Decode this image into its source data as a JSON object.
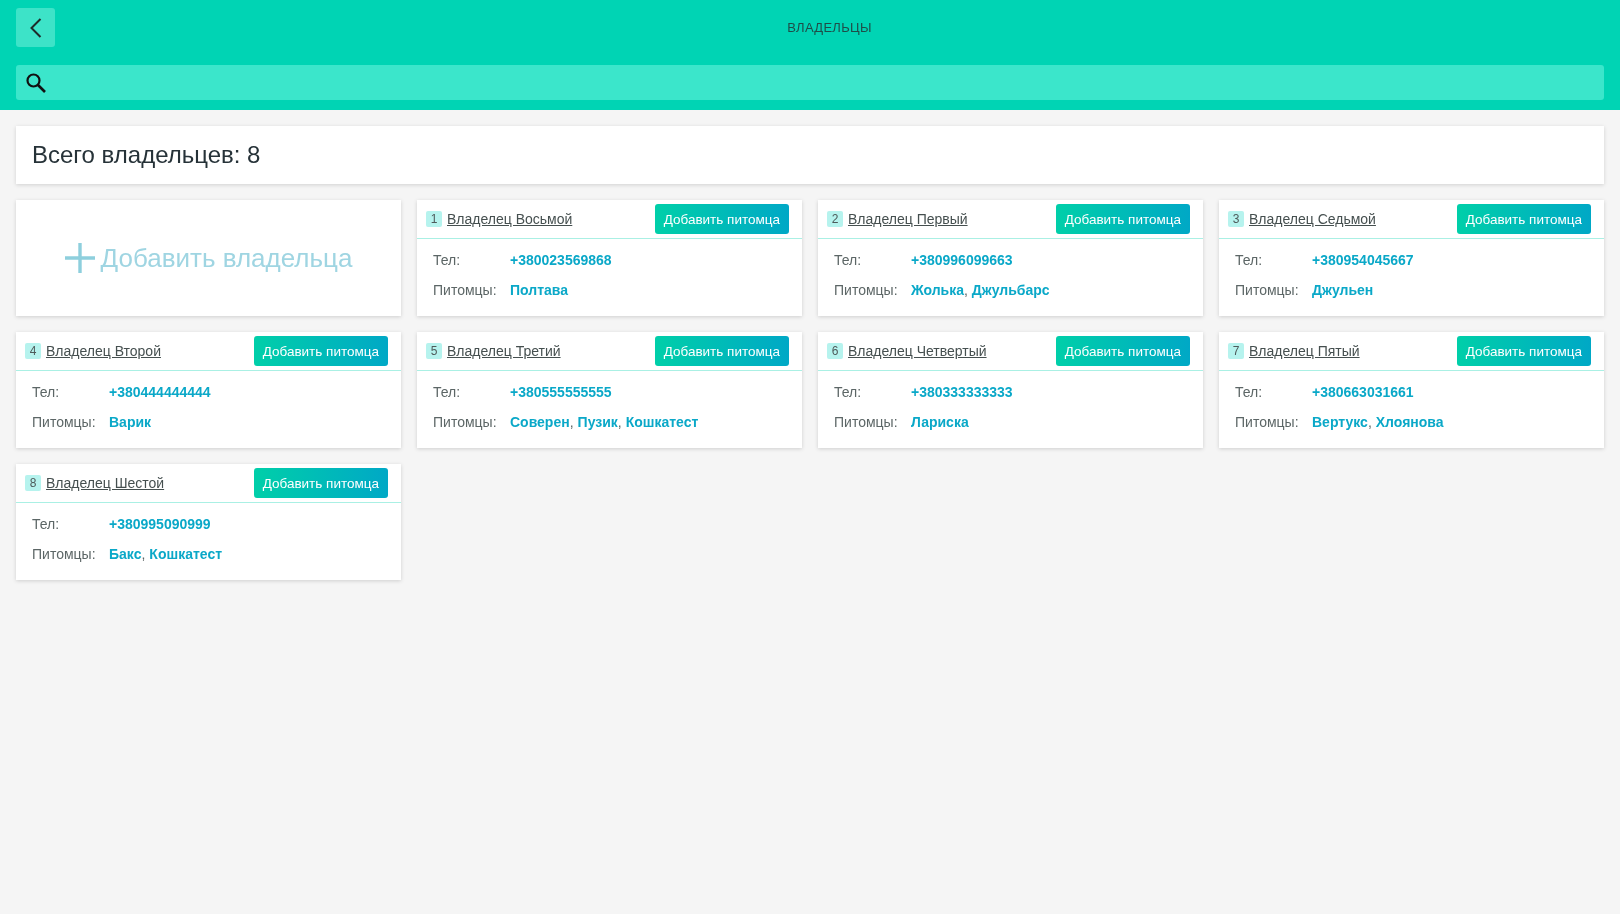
{
  "header": {
    "title": "ВЛАДЕЛЬЦЫ"
  },
  "summary": {
    "text": "Всего владельцев: 8"
  },
  "add_owner": {
    "label": "Добавить владельца"
  },
  "owners": [
    {
      "number": "1",
      "name": "Владелец Восьмой",
      "button": "Добавить питомца",
      "phone_label": "Тел:",
      "phone": "+380023569868",
      "pets_label": "Питомцы:",
      "pets": [
        {
          "name": "Полтава"
        }
      ]
    },
    {
      "number": "2",
      "name": "Владелец Первый",
      "button": "Добавить питомца",
      "phone_label": "Тел:",
      "phone": "+380996099663",
      "pets_label": "Питомцы:",
      "pets": [
        {
          "name": "Жолька",
          "separator": ","
        },
        {
          "name": "Джульбарс"
        }
      ]
    },
    {
      "number": "3",
      "name": "Владелец Седьмой",
      "button": "Добавить питомца",
      "phone_label": "Тел:",
      "phone": "+380954045667",
      "pets_label": "Питомцы:",
      "pets": [
        {
          "name": "Джульен"
        }
      ]
    },
    {
      "number": "4",
      "name": "Владелец Второй",
      "button": "Добавить питомца",
      "phone_label": "Тел:",
      "phone": "+380444444444",
      "pets_label": "Питомцы:",
      "pets": [
        {
          "name": "Варик"
        }
      ]
    },
    {
      "number": "5",
      "name": "Владелец Третий",
      "button": "Добавить питомца",
      "phone_label": "Тел:",
      "phone": "+380555555555",
      "pets_label": "Питомцы:",
      "pets": [
        {
          "name": "Соверен",
          "separator": ","
        },
        {
          "name": "Пузик",
          "separator": ","
        },
        {
          "name": "Кошкатест"
        }
      ]
    },
    {
      "number": "6",
      "name": "Владелец Четвертый",
      "button": "Добавить питомца",
      "phone_label": "Тел:",
      "phone": "+380333333333",
      "pets_label": "Питомцы:",
      "pets": [
        {
          "name": "Лариска"
        }
      ]
    },
    {
      "number": "7",
      "name": "Владелец Пятый",
      "button": "Добавить питомца",
      "phone_label": "Тел:",
      "phone": "+380663031661",
      "pets_label": "Питомцы:",
      "pets": [
        {
          "name": "Вертукс",
          "separator": ","
        },
        {
          "name": "Хлоянова"
        }
      ]
    },
    {
      "number": "8",
      "name": "Владелец Шестой",
      "button": "Добавить питомца",
      "phone_label": "Тел:",
      "phone": "+380995090999",
      "pets_label": "Питомцы:",
      "pets": [
        {
          "name": "Бакс",
          "separator": ","
        },
        {
          "name": "Кошкатест"
        }
      ]
    }
  ]
}
